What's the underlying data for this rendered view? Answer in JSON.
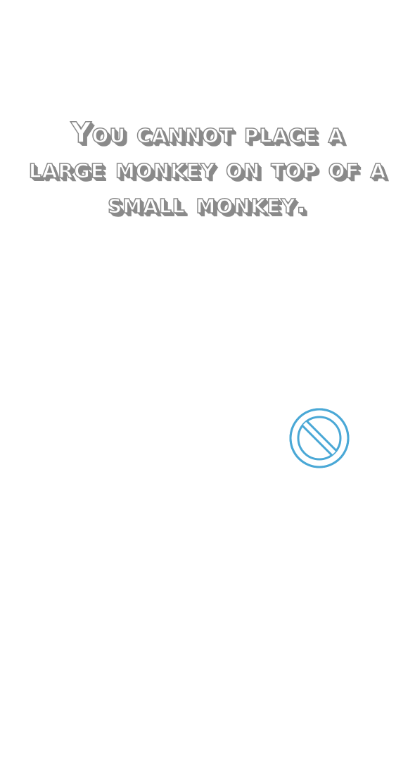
{
  "message": {
    "text": "You cannot place a large monkey on top of a small monkey."
  },
  "icons": {
    "prohibited": "no-entry-icon",
    "prohibited_color": "#4aa8d6"
  },
  "colors": {
    "background": "#ffffff",
    "text_fill": "#ffffff",
    "text_shadow": "#8a8a8a"
  }
}
